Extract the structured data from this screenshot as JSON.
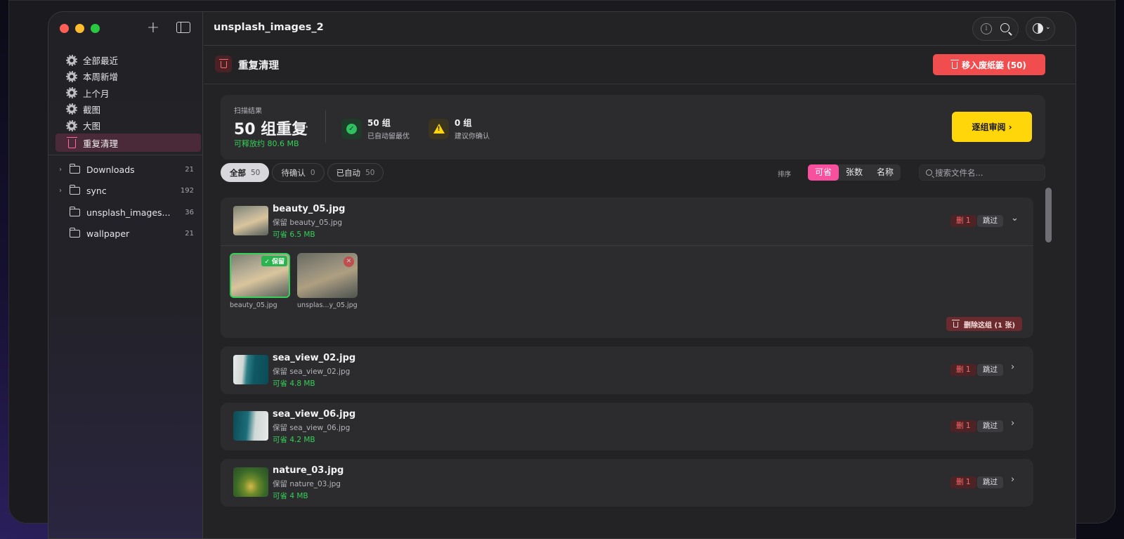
{
  "window": {
    "title": "unsplash_images_2"
  },
  "sidebar": {
    "nav": [
      {
        "label": "全部最近",
        "icon": "gear-icon"
      },
      {
        "label": "本周新增",
        "icon": "gear-icon"
      },
      {
        "label": "上个月",
        "icon": "gear-icon"
      },
      {
        "label": "截图",
        "icon": "gear-icon"
      },
      {
        "label": "大图",
        "icon": "gear-icon"
      },
      {
        "label": "重复清理",
        "icon": "trash-icon",
        "active": true
      }
    ],
    "folders": [
      {
        "name": "Downloads",
        "count": "21",
        "expandable": true
      },
      {
        "name": "sync",
        "count": "192",
        "expandable": true
      },
      {
        "name": "unsplash_images...",
        "count": "36",
        "expandable": false
      },
      {
        "name": "wallpaper",
        "count": "21",
        "expandable": false
      }
    ]
  },
  "header": {
    "title": "重复清理",
    "move_button": "移入废纸篓 (50)"
  },
  "scan": {
    "label": "扫描结果",
    "headline": "50 组重复",
    "savings": "可释放约 80.6 MB",
    "auto_value": "50 组",
    "auto_desc": "已自动留最优",
    "confirm_value": "0 组",
    "confirm_desc": "建议你确认",
    "review_button": "逐组审阅 ›"
  },
  "filters": [
    {
      "label": "全部",
      "count": "50",
      "active": true
    },
    {
      "label": "待确认",
      "count": "0",
      "active": false
    },
    {
      "label": "已自动",
      "count": "50",
      "active": false
    }
  ],
  "sort": {
    "label": "排序",
    "options": [
      "可省",
      "张数",
      "名称"
    ],
    "active": "可省"
  },
  "search": {
    "placeholder": "搜索文件名..."
  },
  "groups": [
    {
      "name": "beauty_05.jpg",
      "keep": "保留 beauty_05.jpg",
      "save": "可省 6.5 MB",
      "del": "删 1",
      "skip": "跳过",
      "expanded": true,
      "tiles": [
        {
          "caption": "beauty_05.jpg",
          "badge": "✓ 保留"
        },
        {
          "caption": "unsplas...y_05.jpg",
          "badge": "✕"
        }
      ],
      "delete_group": "删除这组 (1 张)"
    },
    {
      "name": "sea_view_02.jpg",
      "keep": "保留 sea_view_02.jpg",
      "save": "可省 4.8 MB",
      "del": "删 1",
      "skip": "跳过"
    },
    {
      "name": "sea_view_06.jpg",
      "keep": "保留 sea_view_06.jpg",
      "save": "可省 4.2 MB",
      "del": "删 1",
      "skip": "跳过"
    },
    {
      "name": "nature_03.jpg",
      "keep": "保留 nature_03.jpg",
      "save": "可省 4 MB",
      "del": "删 1",
      "skip": "跳过"
    }
  ],
  "colors": {
    "accent_pink": "#f7509f",
    "danger": "#f14d4f",
    "success": "#34d058",
    "warning": "#ffd60a"
  }
}
